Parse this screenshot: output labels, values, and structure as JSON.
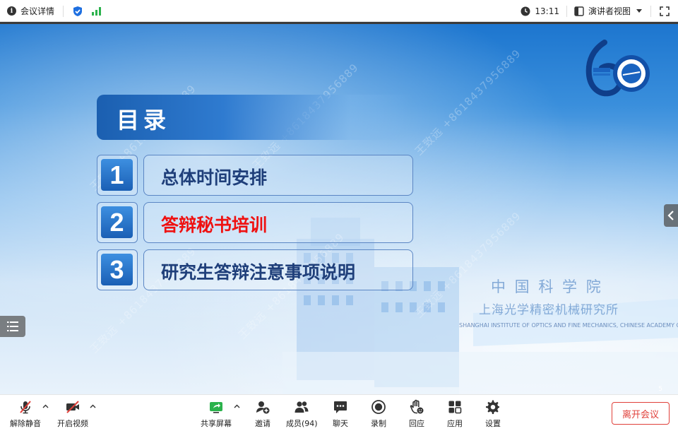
{
  "topbar": {
    "meeting_info_label": "会议详情",
    "time": "13:11",
    "view_label": "演讲者视图"
  },
  "slide": {
    "toc_title": "目录",
    "items": [
      {
        "number": "1",
        "label": "总体时间安排"
      },
      {
        "number": "2",
        "label": "答辩秘书培训"
      },
      {
        "number": "3",
        "label": "研究生答辩注意事项说明"
      }
    ],
    "logo_number": "60",
    "sign_line1": "中 国 科 学 院",
    "sign_line2": "上海光学精密机械研究所",
    "sign_line3": "SHANGHAI INSTITUTE OF OPTICS AND FINE MECHANICS, CHINESE ACADEMY OF SCIENCES",
    "watermark": "王致远 +8618437956889",
    "page_number": "5"
  },
  "toolbar": {
    "unmute_label": "解除静音",
    "start_video_label": "开启视频",
    "share_label": "共享屏幕",
    "invite_label": "邀请",
    "members_label": "成员(94)",
    "chat_label": "聊天",
    "record_label": "录制",
    "reactions_label": "回应",
    "apps_label": "应用",
    "settings_label": "设置",
    "leave_label": "离开会议"
  },
  "colors": {
    "active_item": "#ef1111",
    "item_text": "#1f3f7a",
    "leave_red": "#e0403a",
    "signal_green": "#2bb24c",
    "shield_blue": "#1e6fe0"
  }
}
